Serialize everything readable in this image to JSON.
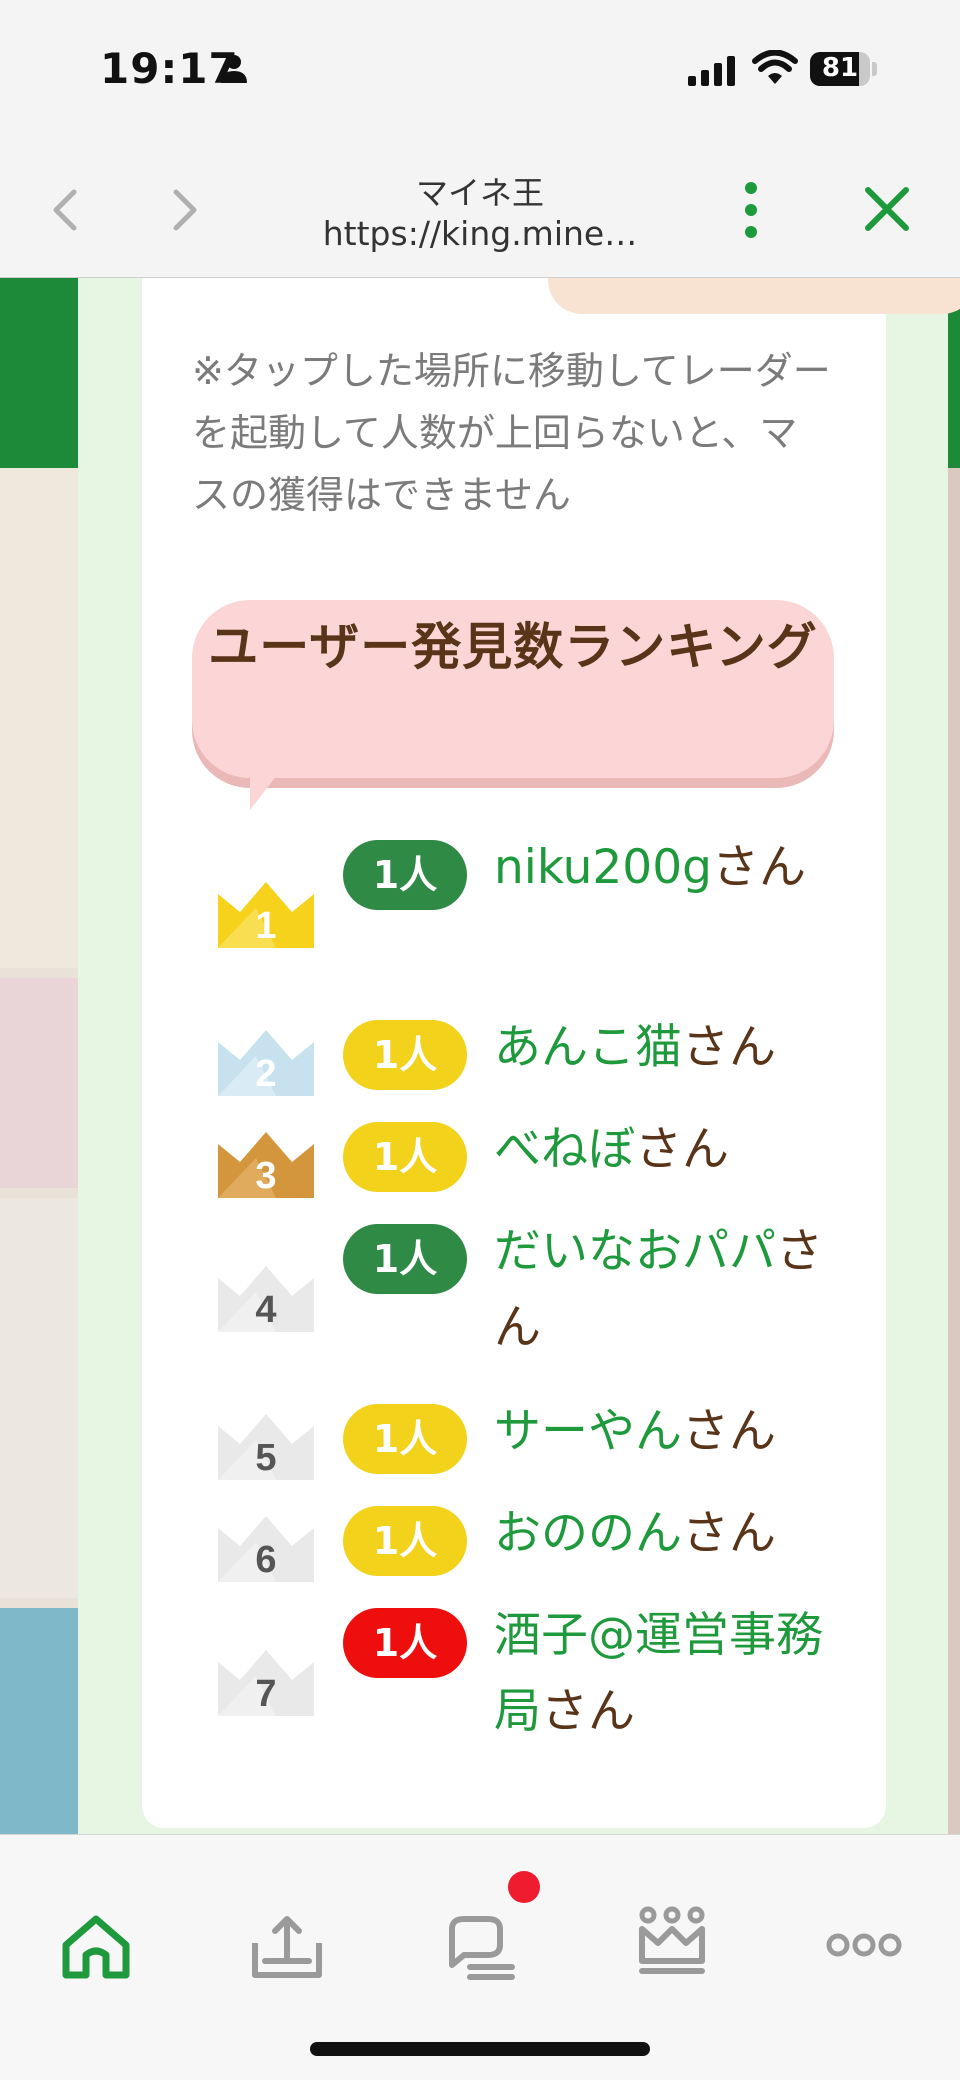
{
  "status_bar": {
    "time": "19:17",
    "battery_level": "81"
  },
  "browser": {
    "title": "マイネ王",
    "url": "https://king.mine…"
  },
  "notice": "※タップした場所に移動してレーダーを起動して人数が上回らないと、マスの獲得はできません",
  "ranking": {
    "heading": "ユーザー発見数ランキング",
    "items": [
      {
        "rank": "1",
        "count": "1人",
        "badge_color": "#2f8a45",
        "name": "niku200g",
        "suffix": "さん",
        "crown": "gold"
      },
      {
        "rank": "2",
        "count": "1人",
        "badge_color": "#f2d21a",
        "name": "あんこ猫",
        "suffix": "さん",
        "crown": "silver"
      },
      {
        "rank": "3",
        "count": "1人",
        "badge_color": "#f2d21a",
        "name": "べねぼ",
        "suffix": "さん",
        "crown": "bronze"
      },
      {
        "rank": "4",
        "count": "1人",
        "badge_color": "#2f8a45",
        "name": "だいなおパパ",
        "suffix": "さん",
        "crown": "gray"
      },
      {
        "rank": "5",
        "count": "1人",
        "badge_color": "#f2d21a",
        "name": "サーやん",
        "suffix": "さん",
        "crown": "gray"
      },
      {
        "rank": "6",
        "count": "1人",
        "badge_color": "#f2d21a",
        "name": "おののん",
        "suffix": "さん",
        "crown": "gray"
      },
      {
        "rank": "7",
        "count": "1人",
        "badge_color": "#ee0e0e",
        "name": "酒子@運営事務局",
        "suffix": "さん",
        "crown": "gray"
      }
    ]
  },
  "tabbar": {
    "items": [
      {
        "icon": "home-icon",
        "active": true
      },
      {
        "icon": "upload-tray-icon",
        "active": false
      },
      {
        "icon": "chat-bubble-icon",
        "active": false,
        "notification": true
      },
      {
        "icon": "crown-icon",
        "active": false
      },
      {
        "icon": "more-dots-icon",
        "active": false
      }
    ]
  },
  "colors": {
    "accent_green": "#1e9a3d",
    "brown": "#5a3418",
    "bubble_pink": "#fcd6d6"
  }
}
